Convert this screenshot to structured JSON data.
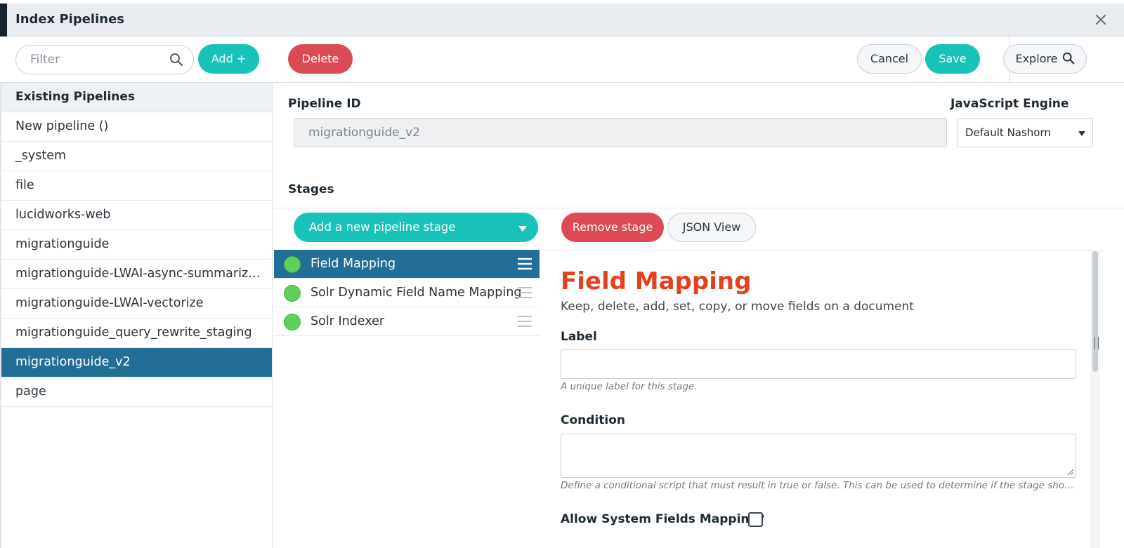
{
  "window": {
    "title": "Index Pipelines",
    "close_icon": "close-icon"
  },
  "toolbar": {
    "filter_placeholder": "Filter",
    "add_label": "Add +",
    "delete_label": "Delete",
    "cancel_label": "Cancel",
    "save_label": "Save",
    "explore_label": "Explore"
  },
  "sidebar": {
    "heading": "Existing Pipelines",
    "items": [
      "New pipeline ()",
      "_system",
      "file",
      "lucidworks-web",
      "migrationguide",
      "migrationguide-LWAI-async-summarizatio…",
      "migrationguide-LWAI-vectorize",
      "migrationguide_query_rewrite_staging",
      "migrationguide_v2",
      "page"
    ],
    "selected": "migrationguide_v2"
  },
  "pipeline": {
    "id_label": "Pipeline ID",
    "id_value": "migrationguide_v2",
    "engine_label": "JavaScript Engine",
    "engine_value": "Default Nashorn"
  },
  "stages": {
    "heading": "Stages",
    "add_stage_label": "Add a new pipeline stage",
    "remove_stage_label": "Remove stage",
    "json_view_label": "JSON View",
    "items": [
      {
        "name": "Field Mapping",
        "active": true,
        "status_color": "#5ecf5e"
      },
      {
        "name": "Solr Dynamic Field Name Mapping",
        "active": false,
        "status_color": "#5ecf5e"
      },
      {
        "name": "Solr Indexer",
        "active": false,
        "status_color": "#5ecf5e"
      }
    ]
  },
  "detail": {
    "title": "Field Mapping",
    "description": "Keep, delete, add, set, copy, or move fields on a document",
    "label_label": "Label",
    "label_value": "",
    "label_help": "A unique label for this stage.",
    "condition_label": "Condition",
    "condition_value": "",
    "condition_help": "Define a conditional script that must result in true or false. This can be used to determine if the stage should process …",
    "system_fields_label": "Allow System Fields Mapping?",
    "system_fields_checked": false
  },
  "colors": {
    "accent_teal": "#19c2b8",
    "danger_red": "#dc4a55",
    "selected_blue": "#236e96",
    "title_orange": "#e4401c"
  }
}
